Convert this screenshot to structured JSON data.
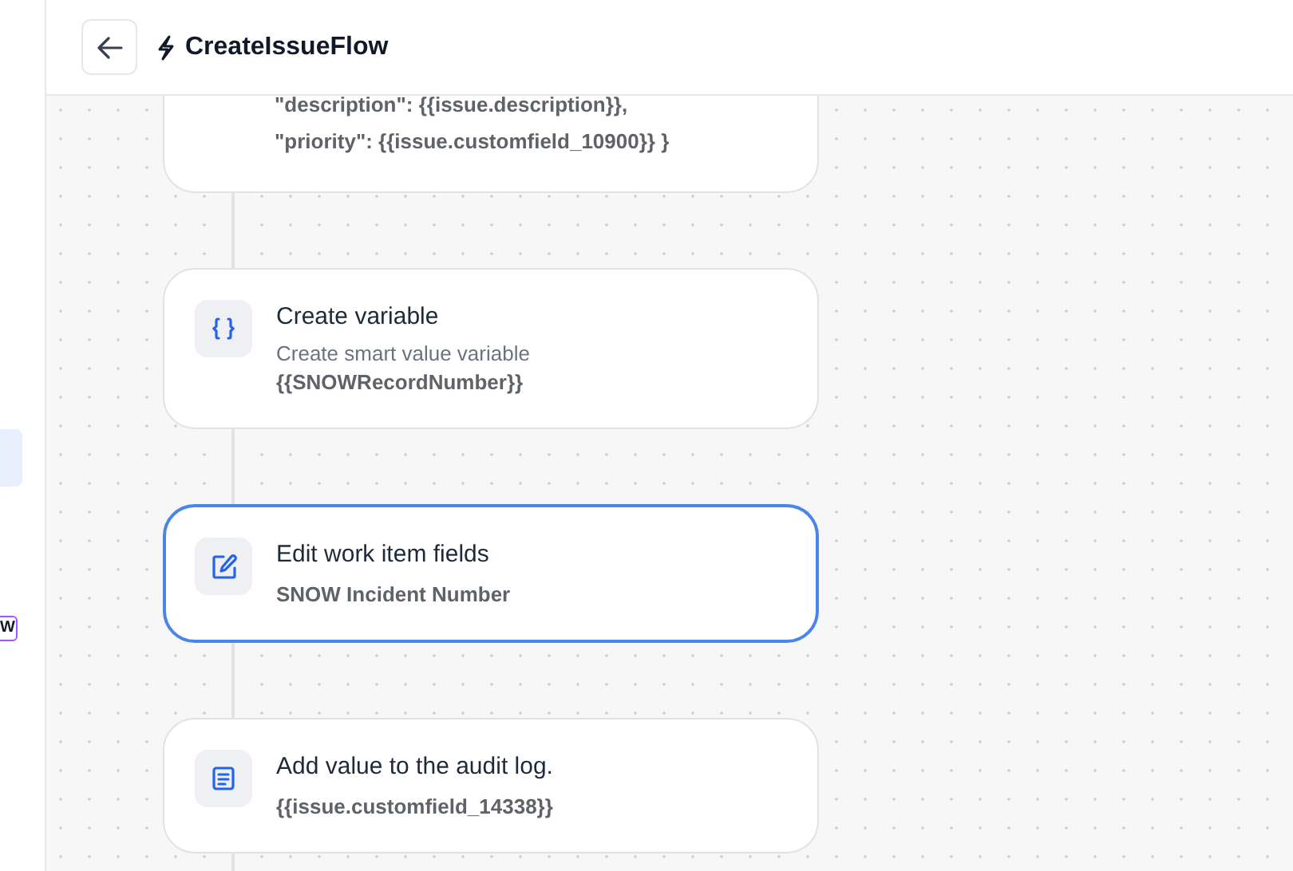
{
  "header": {
    "title": "CreateIssueFlow"
  },
  "sidebar": {
    "items": [
      {
        "selected": true
      }
    ],
    "badge": "W"
  },
  "steps": [
    {
      "kind": "code",
      "selected": false,
      "lines": [
        "\"description\": {{issue.description}},",
        "\"priority\": {{issue.customfield_10900}} }"
      ]
    },
    {
      "kind": "variable",
      "selected": false,
      "title": "Create variable",
      "subtitle": "Create smart value variable",
      "detail": "{{SNOWRecordNumber}}"
    },
    {
      "kind": "edit",
      "selected": true,
      "title": "Edit work item fields",
      "detail": "SNOW Incident Number"
    },
    {
      "kind": "log",
      "selected": false,
      "title": "Add value to the audit log.",
      "detail": "{{issue.customfield_14338}}"
    }
  ]
}
